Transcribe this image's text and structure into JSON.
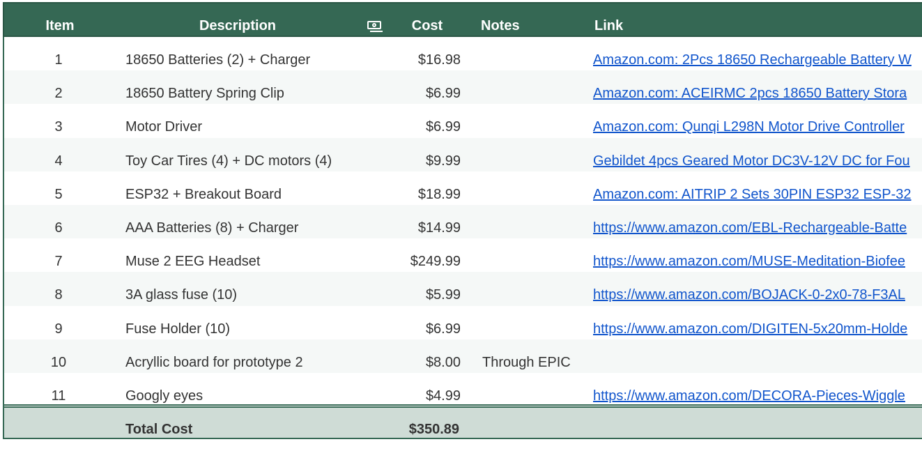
{
  "header": {
    "item": "Item",
    "description": "Description",
    "icon": "money-icon",
    "cost": "Cost",
    "notes": "Notes",
    "link": "Link"
  },
  "colors": {
    "header_bg": "#356854",
    "total_bg": "#cfdcd6",
    "link": "#1155cc"
  },
  "rows": [
    {
      "item": "1",
      "description": "18650 Batteries (2) + Charger",
      "cost": "$16.98",
      "notes": "",
      "link": "Amazon.com: 2Pcs 18650 Rechargeable Battery W"
    },
    {
      "item": "2",
      "description": "18650 Battery Spring Clip",
      "cost": "$6.99",
      "notes": "",
      "link": "Amazon.com: ACEIRMC 2pcs 18650 Battery Stora"
    },
    {
      "item": "3",
      "description": "Motor Driver",
      "cost": "$6.99",
      "notes": "",
      "link": "Amazon.com: Qunqi L298N Motor Drive Controller"
    },
    {
      "item": "4",
      "description": "Toy Car Tires (4) + DC motors (4)",
      "cost": "$9.99",
      "notes": "",
      "link": "Gebildet 4pcs Geared Motor DC3V-12V DC for Fou"
    },
    {
      "item": "5",
      "description": "ESP32 + Breakout Board",
      "cost": "$18.99",
      "notes": "",
      "link": "Amazon.com: AITRIP 2 Sets 30PIN ESP32 ESP-32"
    },
    {
      "item": "6",
      "description": "AAA Batteries (8) + Charger",
      "cost": "$14.99",
      "notes": "",
      "link": "https://www.amazon.com/EBL-Rechargeable-Batte"
    },
    {
      "item": "7",
      "description": "Muse 2 EEG Headset",
      "cost": "$249.99",
      "notes": "",
      "link": "https://www.amazon.com/MUSE-Meditation-Biofee"
    },
    {
      "item": "8",
      "description": "3A glass fuse (10)",
      "cost": "$5.99",
      "notes": "",
      "link": "https://www.amazon.com/BOJACK-0-2x0-78-F3AL"
    },
    {
      "item": "9",
      "description": "Fuse Holder (10)",
      "cost": "$6.99",
      "notes": "",
      "link": "https://www.amazon.com/DIGITEN-5x20mm-Holde"
    },
    {
      "item": "10",
      "description": "Acryllic board for prototype 2",
      "cost": "$8.00",
      "notes": "Through EPIC",
      "link": ""
    },
    {
      "item": "11",
      "description": "Googly eyes",
      "cost": "$4.99",
      "notes": "",
      "link": "https://www.amazon.com/DECORA-Pieces-Wiggle"
    }
  ],
  "total": {
    "label": "Total Cost",
    "value": "$350.89"
  }
}
